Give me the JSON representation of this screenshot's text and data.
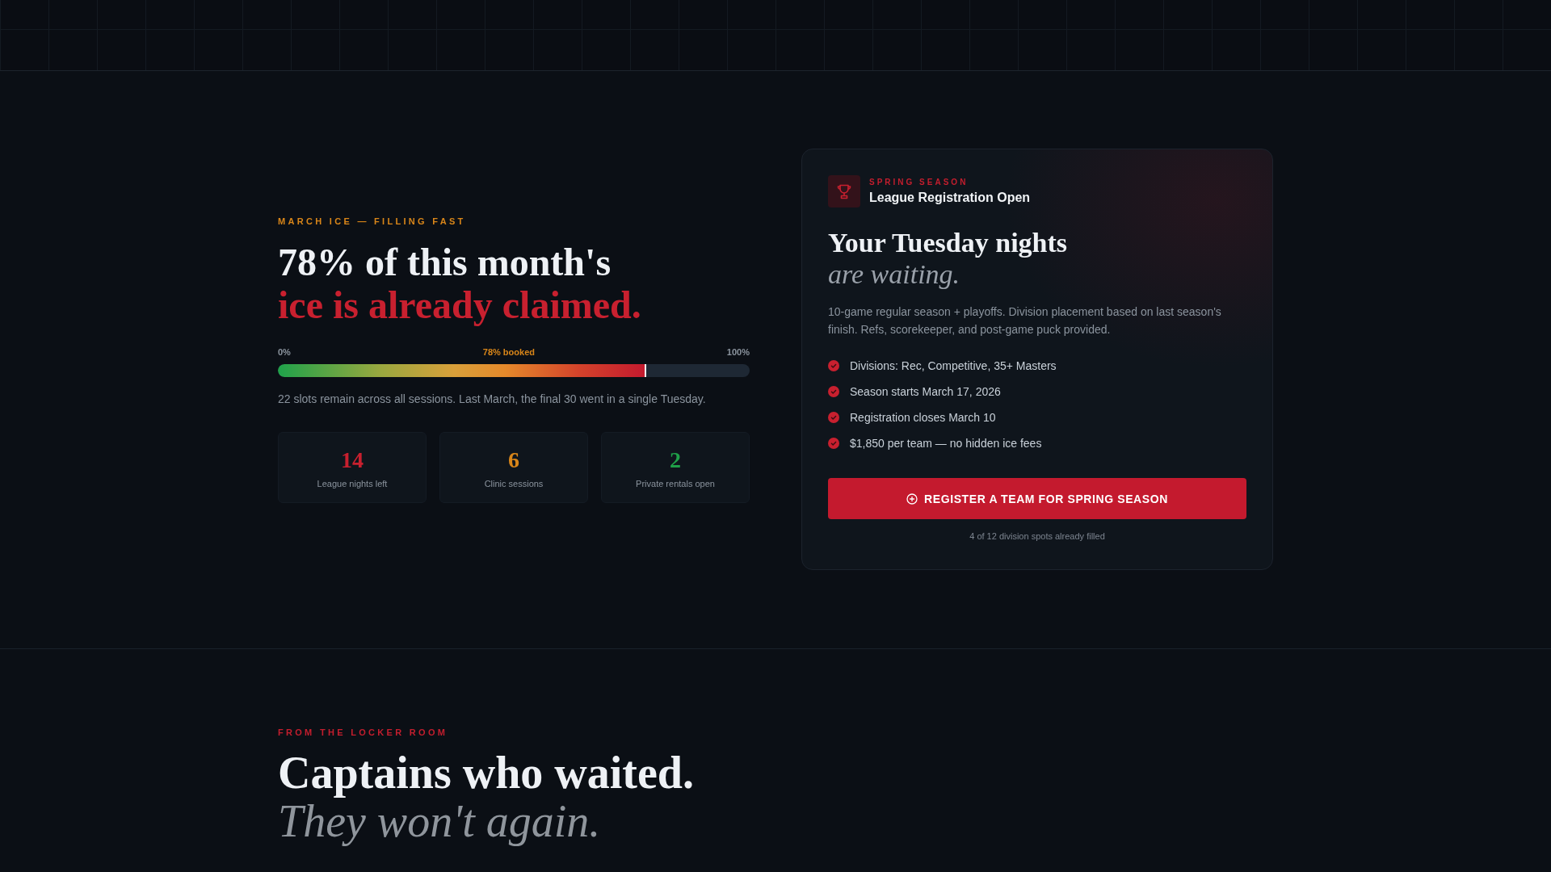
{
  "eyebrow": "MARCH ICE — FILLING FAST",
  "headline": {
    "line_1": "78% of this month's",
    "line_2": "ice is already claimed."
  },
  "progress": {
    "start_label": "0%",
    "level_label": "78% booked",
    "end_label": "100%",
    "level": 0.78
  },
  "caption": "22 slots remain across all sessions. Last March, the final 30 went in a single Tuesday.",
  "stats": [
    {
      "value": "14",
      "label": "League nights left",
      "color": "#c8202f"
    },
    {
      "value": "6",
      "label": "Clinic sessions",
      "color": "#d98619"
    },
    {
      "value": "2",
      "label": "Private rentals open",
      "color": "#1f9f48"
    }
  ],
  "registration_card": {
    "eyebrow": "SPRING SEASON",
    "title": "League Registration Open",
    "heading": {
      "line_1": "Your Tuesday nights",
      "line_2": "are waiting."
    },
    "description": "10-game regular season + playoffs. Division placement based on last season's finish. Refs, scorekeeper, and post-game puck provided.",
    "features": [
      "Divisions: Rec, Competitive, 35+ Masters",
      "Season starts March 17, 2026",
      "Registration closes March 10",
      "$1,850 per team — no hidden ice fees"
    ],
    "button": "REGISTER A TEAM FOR SPRING SEASON",
    "note": "4 of 12 division spots already filled"
  },
  "testimonials": {
    "eyebrow": "FROM THE LOCKER ROOM",
    "heading": {
      "line_1": "Captains who waited.",
      "line_2": "They won't again."
    }
  }
}
